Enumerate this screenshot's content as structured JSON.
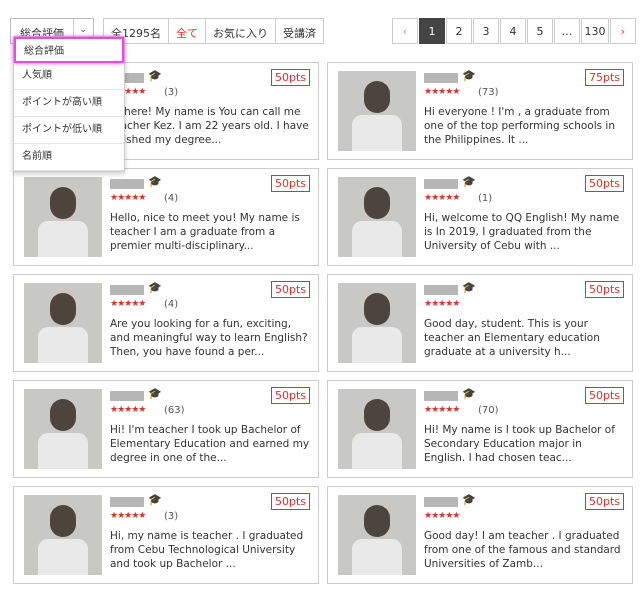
{
  "sort": {
    "selected": "総合評価",
    "options": [
      "総合評価",
      "人気順",
      "ポイントが高い順",
      "ポイントが低い順",
      "名前順"
    ]
  },
  "filters": {
    "count": "全1295名",
    "tabs": [
      "全て",
      "お気に入り",
      "受講済"
    ],
    "active": "全て"
  },
  "pager": {
    "prev": "‹",
    "pages": [
      "1",
      "2",
      "3",
      "4",
      "5",
      "…",
      "130"
    ],
    "current": "1",
    "next": "›"
  },
  "teachers": [
    {
      "reviews": "(3)",
      "points": "50pts",
      "desc": "...there! My name is       You can call me teacher Kez. I am 22 years old. I have finished my degree..."
    },
    {
      "reviews": "(73)",
      "points": "75pts",
      "desc": "Hi everyone ! I'm       , a graduate from one of the top performing schools in the Philippines. It ..."
    },
    {
      "reviews": "(4)",
      "points": "50pts",
      "desc": "Hello, nice to meet you! My name is teacher       I am a graduate from a premier multi-disciplinary..."
    },
    {
      "reviews": "(1)",
      "points": "50pts",
      "desc": "Hi, welcome to QQ English! My name is       In 2019, I graduated from the University of Cebu with ..."
    },
    {
      "reviews": "(4)",
      "points": "50pts",
      "desc": "Are you looking for a fun, exciting, and meaningful way to learn English? Then, you have found a per..."
    },
    {
      "reviews": "",
      "points": "50pts",
      "desc": "Good day, student. This is your teacher       an Elementary education graduate at a university h..."
    },
    {
      "reviews": "(63)",
      "points": "50pts",
      "desc": "Hi! I'm teacher       I took up Bachelor of Elementary Education and earned my degree in one of the..."
    },
    {
      "reviews": "(70)",
      "points": "50pts",
      "desc": "Hi! My name is       I took up Bachelor of Secondary Education major in English. I had chosen teac..."
    },
    {
      "reviews": "(3)",
      "points": "50pts",
      "desc": "Hi, my name is teacher       . I graduated from Cebu Technological University and took up Bachelor ..."
    },
    {
      "reviews": "",
      "points": "50pts",
      "desc": "Good day! I am teacher       . I graduated from one of the famous and standard Universities of Zamb..."
    }
  ],
  "stars": "★★★★★",
  "colors": {
    "accent": "#d9342b",
    "highlight": "#e64ce0"
  }
}
